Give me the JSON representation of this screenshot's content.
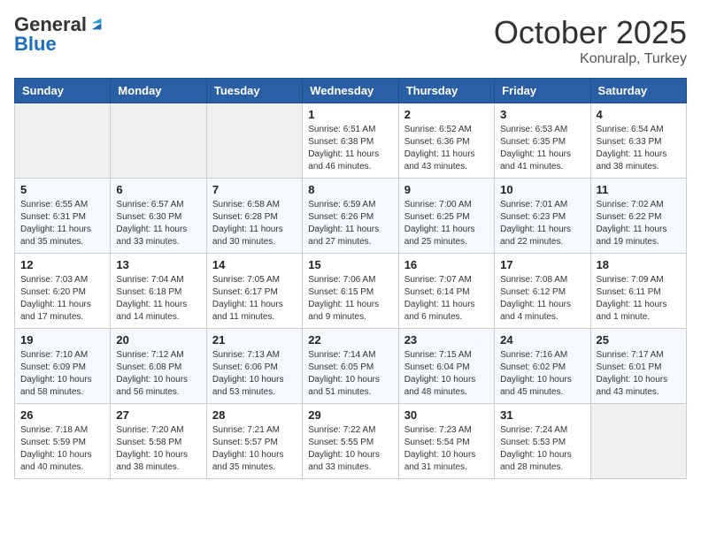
{
  "header": {
    "logo_general": "General",
    "logo_blue": "Blue",
    "month_title": "October 2025",
    "location": "Konuralp, Turkey"
  },
  "days_of_week": [
    "Sunday",
    "Monday",
    "Tuesday",
    "Wednesday",
    "Thursday",
    "Friday",
    "Saturday"
  ],
  "weeks": [
    [
      {
        "day": "",
        "info": ""
      },
      {
        "day": "",
        "info": ""
      },
      {
        "day": "",
        "info": ""
      },
      {
        "day": "1",
        "info": "Sunrise: 6:51 AM\nSunset: 6:38 PM\nDaylight: 11 hours\nand 46 minutes."
      },
      {
        "day": "2",
        "info": "Sunrise: 6:52 AM\nSunset: 6:36 PM\nDaylight: 11 hours\nand 43 minutes."
      },
      {
        "day": "3",
        "info": "Sunrise: 6:53 AM\nSunset: 6:35 PM\nDaylight: 11 hours\nand 41 minutes."
      },
      {
        "day": "4",
        "info": "Sunrise: 6:54 AM\nSunset: 6:33 PM\nDaylight: 11 hours\nand 38 minutes."
      }
    ],
    [
      {
        "day": "5",
        "info": "Sunrise: 6:55 AM\nSunset: 6:31 PM\nDaylight: 11 hours\nand 35 minutes."
      },
      {
        "day": "6",
        "info": "Sunrise: 6:57 AM\nSunset: 6:30 PM\nDaylight: 11 hours\nand 33 minutes."
      },
      {
        "day": "7",
        "info": "Sunrise: 6:58 AM\nSunset: 6:28 PM\nDaylight: 11 hours\nand 30 minutes."
      },
      {
        "day": "8",
        "info": "Sunrise: 6:59 AM\nSunset: 6:26 PM\nDaylight: 11 hours\nand 27 minutes."
      },
      {
        "day": "9",
        "info": "Sunrise: 7:00 AM\nSunset: 6:25 PM\nDaylight: 11 hours\nand 25 minutes."
      },
      {
        "day": "10",
        "info": "Sunrise: 7:01 AM\nSunset: 6:23 PM\nDaylight: 11 hours\nand 22 minutes."
      },
      {
        "day": "11",
        "info": "Sunrise: 7:02 AM\nSunset: 6:22 PM\nDaylight: 11 hours\nand 19 minutes."
      }
    ],
    [
      {
        "day": "12",
        "info": "Sunrise: 7:03 AM\nSunset: 6:20 PM\nDaylight: 11 hours\nand 17 minutes."
      },
      {
        "day": "13",
        "info": "Sunrise: 7:04 AM\nSunset: 6:18 PM\nDaylight: 11 hours\nand 14 minutes."
      },
      {
        "day": "14",
        "info": "Sunrise: 7:05 AM\nSunset: 6:17 PM\nDaylight: 11 hours\nand 11 minutes."
      },
      {
        "day": "15",
        "info": "Sunrise: 7:06 AM\nSunset: 6:15 PM\nDaylight: 11 hours\nand 9 minutes."
      },
      {
        "day": "16",
        "info": "Sunrise: 7:07 AM\nSunset: 6:14 PM\nDaylight: 11 hours\nand 6 minutes."
      },
      {
        "day": "17",
        "info": "Sunrise: 7:08 AM\nSunset: 6:12 PM\nDaylight: 11 hours\nand 4 minutes."
      },
      {
        "day": "18",
        "info": "Sunrise: 7:09 AM\nSunset: 6:11 PM\nDaylight: 11 hours\nand 1 minute."
      }
    ],
    [
      {
        "day": "19",
        "info": "Sunrise: 7:10 AM\nSunset: 6:09 PM\nDaylight: 10 hours\nand 58 minutes."
      },
      {
        "day": "20",
        "info": "Sunrise: 7:12 AM\nSunset: 6:08 PM\nDaylight: 10 hours\nand 56 minutes."
      },
      {
        "day": "21",
        "info": "Sunrise: 7:13 AM\nSunset: 6:06 PM\nDaylight: 10 hours\nand 53 minutes."
      },
      {
        "day": "22",
        "info": "Sunrise: 7:14 AM\nSunset: 6:05 PM\nDaylight: 10 hours\nand 51 minutes."
      },
      {
        "day": "23",
        "info": "Sunrise: 7:15 AM\nSunset: 6:04 PM\nDaylight: 10 hours\nand 48 minutes."
      },
      {
        "day": "24",
        "info": "Sunrise: 7:16 AM\nSunset: 6:02 PM\nDaylight: 10 hours\nand 45 minutes."
      },
      {
        "day": "25",
        "info": "Sunrise: 7:17 AM\nSunset: 6:01 PM\nDaylight: 10 hours\nand 43 minutes."
      }
    ],
    [
      {
        "day": "26",
        "info": "Sunrise: 7:18 AM\nSunset: 5:59 PM\nDaylight: 10 hours\nand 40 minutes."
      },
      {
        "day": "27",
        "info": "Sunrise: 7:20 AM\nSunset: 5:58 PM\nDaylight: 10 hours\nand 38 minutes."
      },
      {
        "day": "28",
        "info": "Sunrise: 7:21 AM\nSunset: 5:57 PM\nDaylight: 10 hours\nand 35 minutes."
      },
      {
        "day": "29",
        "info": "Sunrise: 7:22 AM\nSunset: 5:55 PM\nDaylight: 10 hours\nand 33 minutes."
      },
      {
        "day": "30",
        "info": "Sunrise: 7:23 AM\nSunset: 5:54 PM\nDaylight: 10 hours\nand 31 minutes."
      },
      {
        "day": "31",
        "info": "Sunrise: 7:24 AM\nSunset: 5:53 PM\nDaylight: 10 hours\nand 28 minutes."
      },
      {
        "day": "",
        "info": ""
      }
    ]
  ]
}
